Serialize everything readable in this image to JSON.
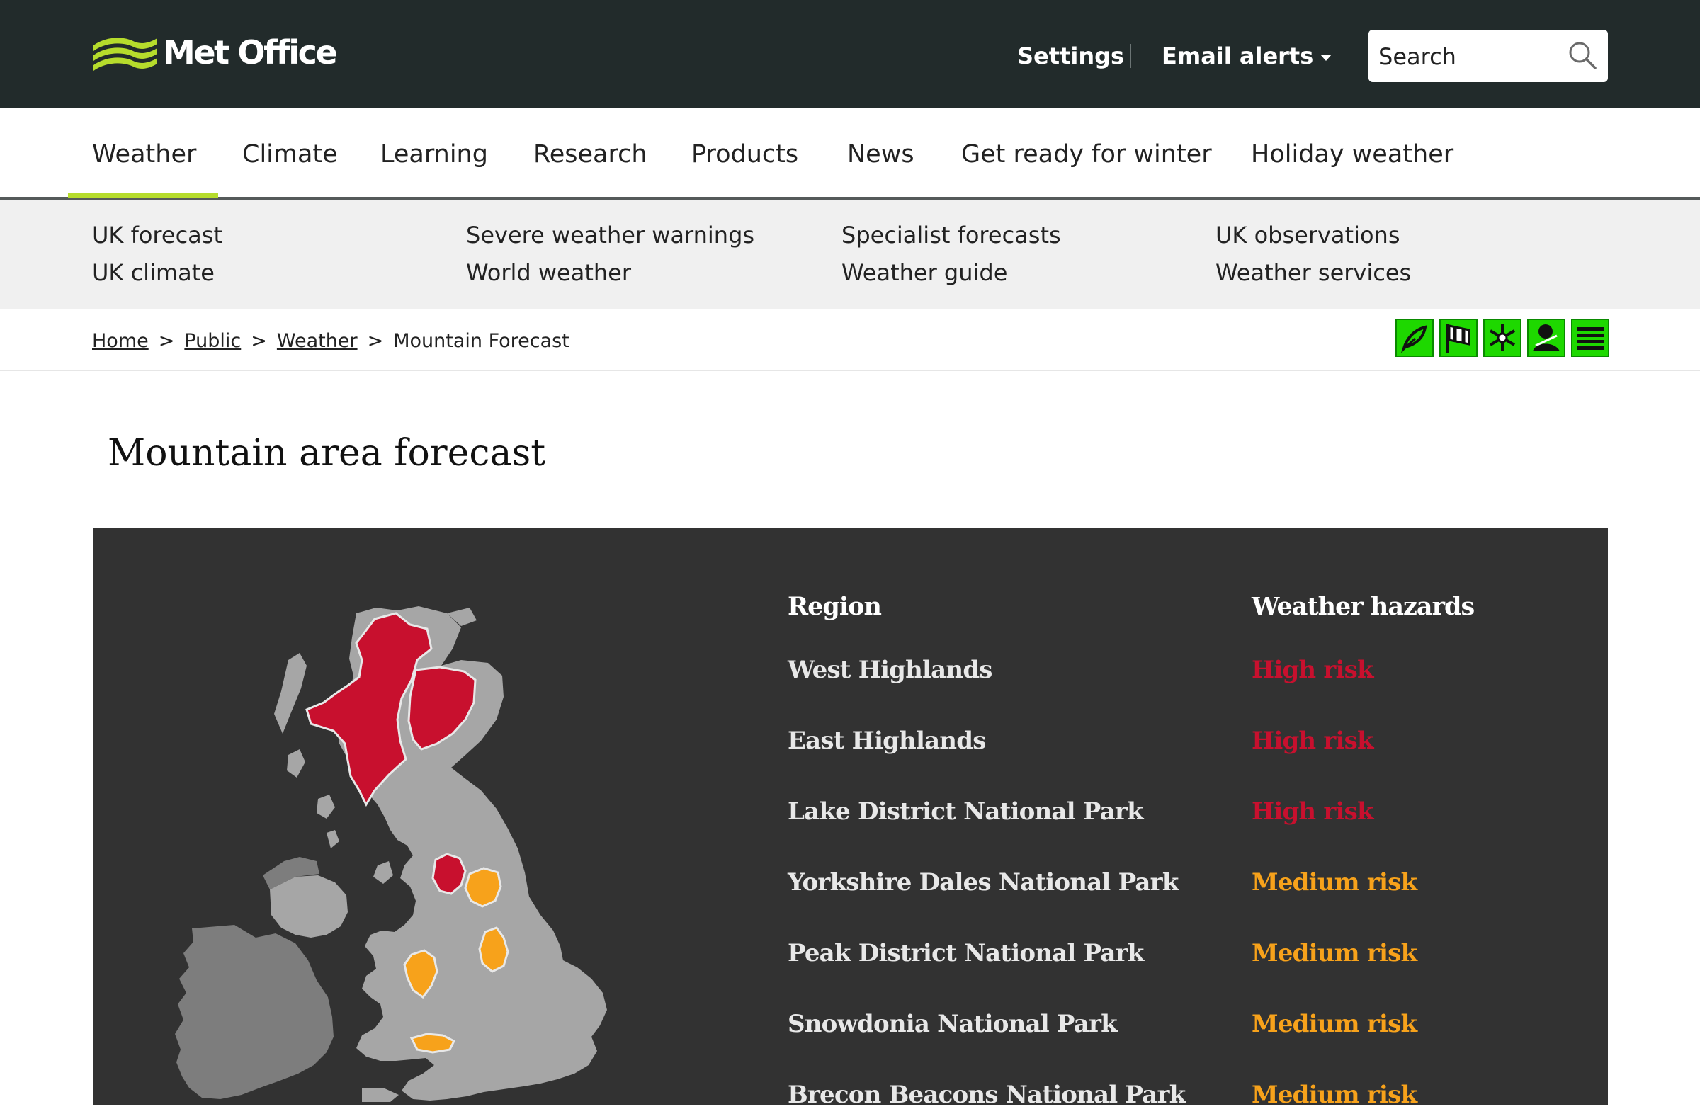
{
  "header": {
    "logo_text": "Met Office",
    "settings_label": "Settings",
    "email_alerts_label": "Email alerts",
    "search_placeholder": "Search"
  },
  "main_nav": [
    {
      "label": "Weather",
      "active": true
    },
    {
      "label": "Climate"
    },
    {
      "label": "Learning"
    },
    {
      "label": "Research"
    },
    {
      "label": "Products"
    },
    {
      "label": "News"
    },
    {
      "label": "Get ready for winter"
    },
    {
      "label": "Holiday weather"
    }
  ],
  "sub_nav": [
    "UK forecast",
    "UK climate",
    "Severe weather warnings",
    "World weather",
    "Specialist forecasts",
    "Weather guide",
    "UK observations",
    "Weather services"
  ],
  "breadcrumb": {
    "items": [
      "Home",
      "Public",
      "Weather"
    ],
    "separator": ">",
    "current": "Mountain Forecast"
  },
  "share_icons": [
    "leaf-icon",
    "flag-icon",
    "snowflake-icon",
    "figure-icon",
    "menu-icon"
  ],
  "page_title": "Mountain area forecast",
  "forecast": {
    "region_header": "Region",
    "hazard_header": "Weather hazards",
    "rows": [
      {
        "region": "West Highlands",
        "hazard": "High risk",
        "level": "high"
      },
      {
        "region": "East Highlands",
        "hazard": "High risk",
        "level": "high"
      },
      {
        "region": "Lake District National Park",
        "hazard": "High risk",
        "level": "high"
      },
      {
        "region": "Yorkshire Dales National Park",
        "hazard": "Medium risk",
        "level": "medium"
      },
      {
        "region": "Peak District National Park",
        "hazard": "Medium risk",
        "level": "medium"
      },
      {
        "region": "Snowdonia National Park",
        "hazard": "Medium risk",
        "level": "medium"
      },
      {
        "region": "Brecon Beacons National Park",
        "hazard": "Medium risk",
        "level": "medium"
      }
    ]
  },
  "colors": {
    "high_risk": "#c8102e",
    "medium_risk": "#f7a21b",
    "accent": "#b6dc2c",
    "header_bg": "#222b2b",
    "panel_bg": "#323232"
  }
}
